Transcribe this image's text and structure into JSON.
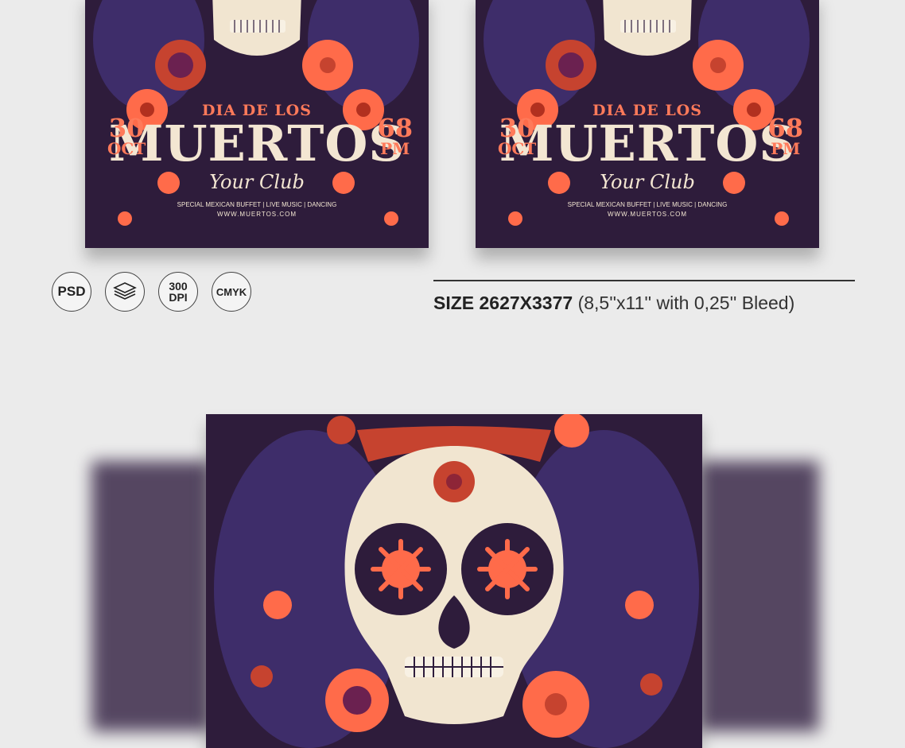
{
  "flyer": {
    "title_small": "DIA DE LOS",
    "title_big": "MUERTOS",
    "script": "Your Club",
    "date_day": "30",
    "date_month": "OCT",
    "time_hour": "68",
    "time_ampm": "PM",
    "details": "SPECIAL MEXICAN BUFFET | LIVE MUSIC | DANCING",
    "url": "WWW.MUERTOS.COM"
  },
  "badges": {
    "psd": "PSD",
    "layers_icon": "layers-icon",
    "dpi_top": "300",
    "dpi_bottom": "DPI",
    "cmyk": "CMYK"
  },
  "size": {
    "label": "SIZE 2627X3377",
    "note": "(8,5''x11'' with 0,25'' Bleed)"
  },
  "colors": {
    "background": "#ebebeb",
    "flyer_bg": "#2e1c3b",
    "accent_orange": "#ff7a5a",
    "cream": "#f3e6d2",
    "red": "#d2412f",
    "purple": "#4a3575"
  }
}
